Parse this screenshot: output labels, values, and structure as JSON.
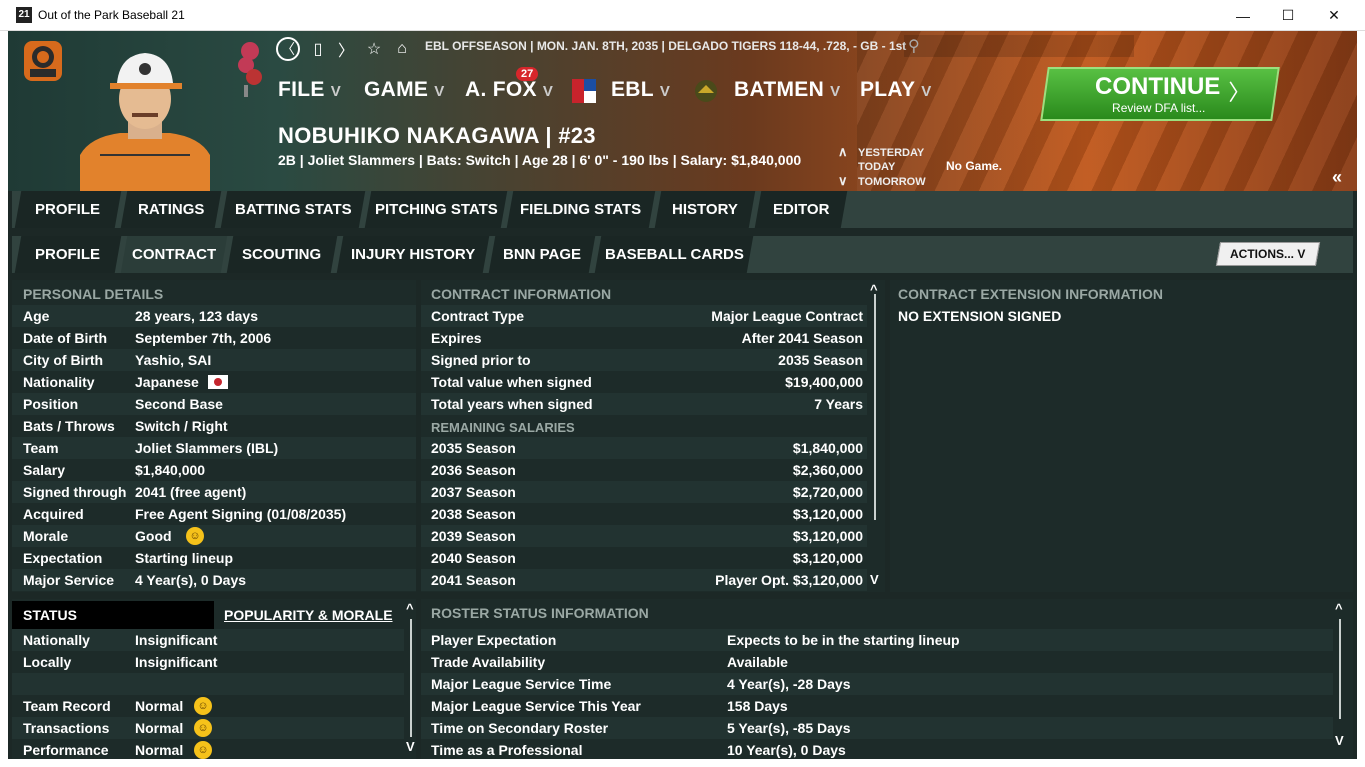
{
  "window": {
    "icon_text": "21",
    "title": "Out of the Park Baseball 21",
    "minimize": "—",
    "maximize": "☐",
    "close": "✕"
  },
  "topbar": {
    "info": "EBL OFFSEASON  |  MON. JAN. 8TH, 2035  |  DELGADO TIGERS  118-44, .728, - GB - 1st",
    "nav_icons": [
      "chevron-left-icon",
      "bookmark-icon",
      "chevron-right-icon",
      "star-icon",
      "home-icon",
      "search-icon"
    ]
  },
  "menu": {
    "file": "FILE",
    "game": "GAME",
    "manager": "A. FOX",
    "manager_badge": "27",
    "league": "EBL",
    "team": "BATMEN",
    "play": "PLAY",
    "chevron": "V"
  },
  "continue": {
    "label": "CONTINUE",
    "sub": "Review DFA list...",
    "arrow": "〉"
  },
  "player": {
    "name": "NOBUHIKO NAKAGAWA  |  #23",
    "info": "2B | Joliet Slammers  |  Bats: Switch  |  Age 28  |  6' 0\" - 190 lbs  |  Salary: $1,840,000"
  },
  "days": {
    "yesterday": "YESTERDAY",
    "today": "TODAY",
    "tomorrow": "TOMORROW",
    "up": "∧",
    "down": "∨",
    "today_text": "No Game.",
    "collapse": "«"
  },
  "tabs1": [
    "PROFILE",
    "RATINGS",
    "BATTING STATS",
    "PITCHING STATS",
    "FIELDING STATS",
    "HISTORY",
    "EDITOR"
  ],
  "tabs2": [
    "PROFILE",
    "CONTRACT",
    "SCOUTING",
    "INJURY HISTORY",
    "BNN PAGE",
    "BASEBALL CARDS"
  ],
  "actions": "ACTIONS...  V",
  "personal": {
    "title": "PERSONAL DETAILS",
    "rows": [
      {
        "label": "Age",
        "value": "28 years, 123 days"
      },
      {
        "label": "Date of Birth",
        "value": "September 7th, 2006"
      },
      {
        "label": "City of Birth",
        "value": "Yashio, SAI"
      },
      {
        "label": "Nationality",
        "value": "Japanese"
      },
      {
        "label": "Position",
        "value": "Second Base"
      },
      {
        "label": "Bats / Throws",
        "value": "Switch / Right"
      },
      {
        "label": "Team",
        "value": "Joliet Slammers (IBL)"
      },
      {
        "label": "Salary",
        "value": "$1,840,000"
      },
      {
        "label": "Signed through",
        "value": "2041 (free agent)"
      },
      {
        "label": "Acquired",
        "value": "Free Agent Signing (01/08/2035)"
      },
      {
        "label": "Morale",
        "value": "Good"
      },
      {
        "label": "Expectation",
        "value": "Starting lineup"
      },
      {
        "label": "Major Service",
        "value": "4 Year(s), 0 Days"
      }
    ]
  },
  "contract": {
    "title": "CONTRACT INFORMATION",
    "rows": [
      {
        "label": "Contract Type",
        "value": "Major League Contract"
      },
      {
        "label": "Expires",
        "value": "After 2041 Season"
      },
      {
        "label": "Signed prior to",
        "value": "2035 Season"
      },
      {
        "label": "Total value when signed",
        "value": "$19,400,000"
      },
      {
        "label": "Total years when signed",
        "value": "7 Years"
      }
    ],
    "remaining_title": "REMAINING SALARIES",
    "salaries": [
      {
        "label": "2035 Season",
        "value": "$1,840,000"
      },
      {
        "label": "2036 Season",
        "value": "$2,360,000"
      },
      {
        "label": "2037 Season",
        "value": "$2,720,000"
      },
      {
        "label": "2038 Season",
        "value": "$3,120,000"
      },
      {
        "label": "2039 Season",
        "value": "$3,120,000"
      },
      {
        "label": "2040 Season",
        "value": "$3,120,000"
      },
      {
        "label": "2041 Season",
        "value": "Player Opt. $3,120,000"
      }
    ]
  },
  "extension": {
    "title": "CONTRACT EXTENSION INFORMATION",
    "value": "NO EXTENSION SIGNED"
  },
  "status": {
    "title": "STATUS",
    "tab2": "POPULARITY & MORALE",
    "rows": [
      {
        "label": "Nationally",
        "value": "Insignificant"
      },
      {
        "label": "Locally",
        "value": "Insignificant"
      },
      {
        "label": "",
        "value": ""
      },
      {
        "label": "Team Record",
        "value": "Normal"
      },
      {
        "label": "Transactions",
        "value": "Normal"
      },
      {
        "label": "Performance",
        "value": "Normal"
      }
    ]
  },
  "roster": {
    "title": "ROSTER STATUS INFORMATION",
    "rows": [
      {
        "label": "Player Expectation",
        "value": "Expects to be in the starting lineup"
      },
      {
        "label": "Trade Availability",
        "value": "Available"
      },
      {
        "label": "Major League Service Time",
        "value": "4 Year(s), -28 Days"
      },
      {
        "label": "Major League Service This Year",
        "value": "158 Days"
      },
      {
        "label": "Time on Secondary Roster",
        "value": "5 Year(s), -85 Days"
      },
      {
        "label": "Time as a Professional",
        "value": "10 Year(s), 0 Days"
      }
    ]
  },
  "scroll": {
    "up": "^",
    "down": "V"
  }
}
